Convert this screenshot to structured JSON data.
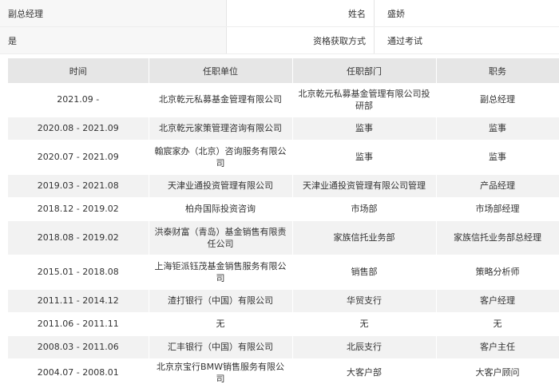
{
  "info": {
    "row1": {
      "left": "副总经理",
      "label": "姓名",
      "value": "盛娇"
    },
    "row2": {
      "left": "是",
      "label": "资格获取方式",
      "value": "通过考试"
    }
  },
  "table": {
    "headers": [
      "时间",
      "任职单位",
      "任职部门",
      "职务"
    ],
    "rows": [
      [
        "2021.09 -",
        "北京乾元私募基金管理有限公司",
        "北京乾元私募基金管理有限公司投研部",
        "副总经理"
      ],
      [
        "2020.08 - 2021.09",
        "北京乾元家策管理咨询有限公司",
        "监事",
        "监事"
      ],
      [
        "2020.07 - 2021.09",
        "翰宸家办（北京）咨询服务有限公司",
        "监事",
        "监事"
      ],
      [
        "2019.03 - 2021.08",
        "天津业通投资管理有限公司",
        "天津业通投资管理有限公司管理",
        "产品经理"
      ],
      [
        "2018.12 - 2019.02",
        "柏舟国际投资咨询",
        "市场部",
        "市场部经理"
      ],
      [
        "2018.08 - 2019.02",
        "洪泰财富（青岛）基金销售有限责任公司",
        "家族信托业务部",
        "家族信托业务部总经理"
      ],
      [
        "2015.01 - 2018.08",
        "上海钜派钰茂基金销售服务有限公司",
        "销售部",
        "策略分析师"
      ],
      [
        "2011.11 - 2014.12",
        "渣打银行（中国）有限公司",
        "华贸支行",
        "客户经理"
      ],
      [
        "2011.06 - 2011.11",
        "无",
        "无",
        "无"
      ],
      [
        "2008.03 - 2011.06",
        "汇丰银行（中国）有限公司",
        "北辰支行",
        "客户主任"
      ],
      [
        "2004.07 - 2008.01",
        "北京京宝行BMW销售服务有限公司",
        "大客户部",
        "大客户顾问"
      ]
    ]
  }
}
